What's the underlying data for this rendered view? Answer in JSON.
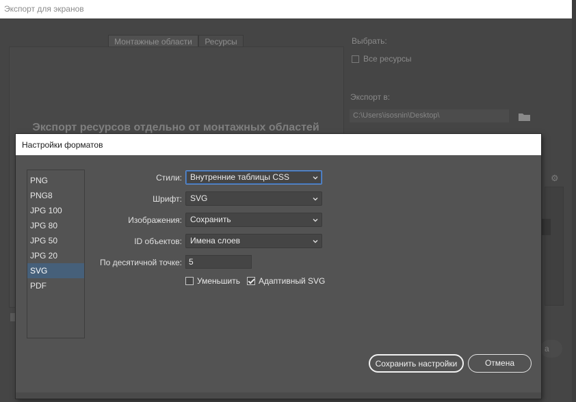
{
  "background": {
    "window_title": "Экспорт для экранов",
    "tabs": [
      "Монтажные области",
      "Ресурсы"
    ],
    "preview_message": "Экспорт ресурсов отдельно от монтажных областей",
    "select_label": "Выбрать:",
    "all_assets_label": "Все ресурсы",
    "export_to_label": "Экспорт в:",
    "export_path": "C:\\Users\\isosnin\\Desktop\\",
    "bottom_button_fragment": "а"
  },
  "dialog": {
    "title": "Настройки форматов",
    "formats": [
      "PNG",
      "PNG8",
      "JPG 100",
      "JPG 80",
      "JPG 50",
      "JPG 20",
      "SVG",
      "PDF"
    ],
    "selected_format": "SVG",
    "styles": {
      "label": "Стили:",
      "value": "Внутренние таблицы CSS"
    },
    "font": {
      "label": "Шрифт:",
      "value": "SVG"
    },
    "images": {
      "label": "Изображения:",
      "value": "Сохранить"
    },
    "object_ids": {
      "label": "ID объектов:",
      "value": "Имена слоев"
    },
    "decimal": {
      "label": "По десятичной точке:",
      "value": "5"
    },
    "minify": {
      "label": "Уменьшить",
      "checked": false
    },
    "responsive": {
      "label": "Адаптивный SVG",
      "checked": true
    },
    "save_button": "Сохранить настройки",
    "cancel_button": "Отмена"
  },
  "colors": {
    "selection": "#46607a",
    "focus_border": "#5b8fd6",
    "dialog_bg": "#535353",
    "backdrop": "#454545"
  }
}
